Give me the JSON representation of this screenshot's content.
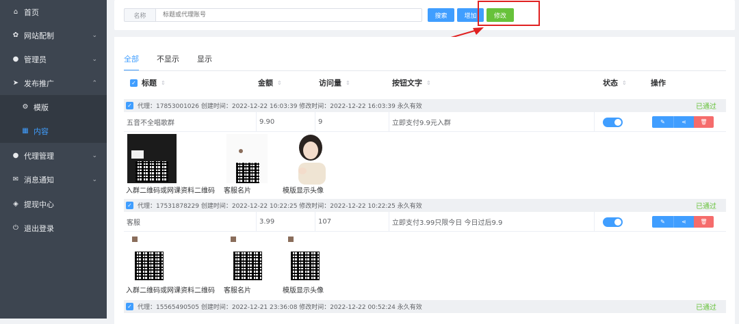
{
  "sidebar": {
    "items": [
      {
        "label": "首页",
        "icon": "home-icon",
        "glyph": "⌂"
      },
      {
        "label": "网站配制",
        "icon": "gear-icon",
        "glyph": "✿",
        "chev": "⌄"
      },
      {
        "label": "管理员",
        "icon": "user-icon",
        "glyph": "●",
        "chev": "⌄"
      },
      {
        "label": "发布推广",
        "icon": "send-icon",
        "glyph": "➤",
        "chev": "⌃"
      },
      {
        "label": "模版",
        "icon": "settings-icon",
        "glyph": "⚙"
      },
      {
        "label": "内容",
        "icon": "content-icon",
        "glyph": "▦"
      },
      {
        "label": "代理管理",
        "icon": "user-icon",
        "glyph": "●",
        "chev": "⌄"
      },
      {
        "label": "消息通知",
        "icon": "mail-icon",
        "glyph": "✉",
        "chev": "⌄"
      },
      {
        "label": "提现中心",
        "icon": "wallet-icon",
        "glyph": "◈"
      },
      {
        "label": "退出登录",
        "icon": "power-icon",
        "glyph": "⏻"
      }
    ]
  },
  "search": {
    "label": "名称",
    "placeholder": "标题或代理账号",
    "search_btn": "搜索",
    "add_btn": "增加",
    "edit_btn": "修改"
  },
  "tabs": [
    "全部",
    "不显示",
    "显示"
  ],
  "table": {
    "headers": [
      "标题",
      "金额",
      "访问量",
      "按钮文字",
      "状态",
      "操作"
    ],
    "sort_icon": "⇕",
    "check": "✓",
    "icons": {
      "edit": "✎",
      "share": "⋖",
      "delete": "🗑"
    }
  },
  "groups": [
    {
      "header": "代理：17853001026   创建时间：2022-12-22 16:03:39   修改时间：2022-12-22 16:03:39   永久有效",
      "status": "已通过",
      "title": "五音不全唱歌群",
      "amount": "9.90",
      "visits": "9",
      "button_text": "立即支付9.9元入群",
      "captions": [
        "入群二维码或网课资料二维码",
        "客服名片",
        "模版显示头像"
      ]
    },
    {
      "header": "代理：17531878229   创建时间：2022-12-22 10:22:25   修改时间：2022-12-22 10:22:25   永久有效",
      "status": "已通过",
      "title": "客服",
      "amount": "3.99",
      "visits": "107",
      "button_text": "立即支付3.99只限今日 今日过后9.9",
      "captions": [
        "入群二维码或网课资料二维码",
        "客服名片",
        "模版显示头像"
      ]
    },
    {
      "header": "代理：15565490505   创建时间：2022-12-21 23:36:08   修改时间：2022-12-22 00:52:24   永久有效",
      "status": "已通过"
    }
  ],
  "colors": {
    "accent": "#409eff",
    "success": "#67c23a",
    "danger": "#f56c6c",
    "sidebar": "#3d4550",
    "annotation": "#e02020"
  }
}
